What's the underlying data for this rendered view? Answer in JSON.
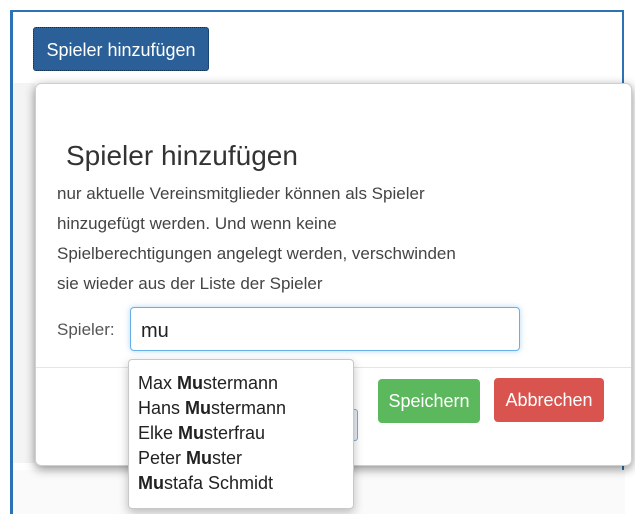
{
  "toolbar": {
    "add_player_label": "Spieler hinzufügen"
  },
  "modal": {
    "title": "Spieler hinzufügen",
    "description_lines": [
      "nur aktuelle Vereinsmitglieder können als Spieler",
      "hinzugefügt werden. Und wenn keine",
      "Spielberechtigungen angelegt werden, verschwinden",
      "sie wieder aus der Liste der Spieler"
    ],
    "player_label": "Spieler:",
    "search_value": "mu",
    "save_label": "Speichern",
    "cancel_label": "Abbrechen"
  },
  "suggestions": [
    {
      "match": "Mu",
      "before": "Max ",
      "after": "stermann"
    },
    {
      "match": "Mu",
      "before": "Hans ",
      "after": "stermann"
    },
    {
      "match": "Mu",
      "before": "Elke ",
      "after": "sterfrau"
    },
    {
      "match": "Mu",
      "before": "Peter ",
      "after": "ster"
    },
    {
      "match": "Mu",
      "before": "",
      "after": "stafa Schmidt"
    }
  ],
  "colors": {
    "primary": "#2a5f98",
    "success": "#5cb85c",
    "danger": "#d9534f",
    "focus": "#66afe9"
  }
}
